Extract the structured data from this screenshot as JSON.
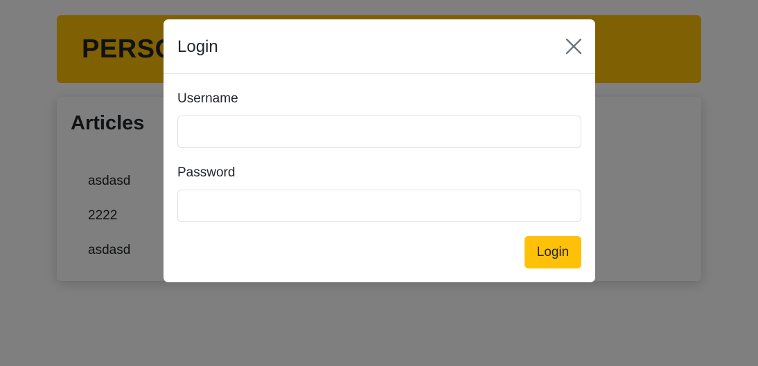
{
  "header": {
    "title": "PERSONAL BLOG"
  },
  "articles": {
    "title": "Articles",
    "items": [
      "asdasd",
      "2222",
      "asdasd"
    ]
  },
  "modal": {
    "title": "Login",
    "close_icon": "close-icon",
    "username_label": "Username",
    "username_value": "",
    "password_label": "Password",
    "password_value": "",
    "submit_label": "Login"
  },
  "colors": {
    "accent": "#ffc107",
    "backdrop": "rgba(0,0,0,0.5)",
    "border": "#dee2e6",
    "text": "#212529"
  }
}
